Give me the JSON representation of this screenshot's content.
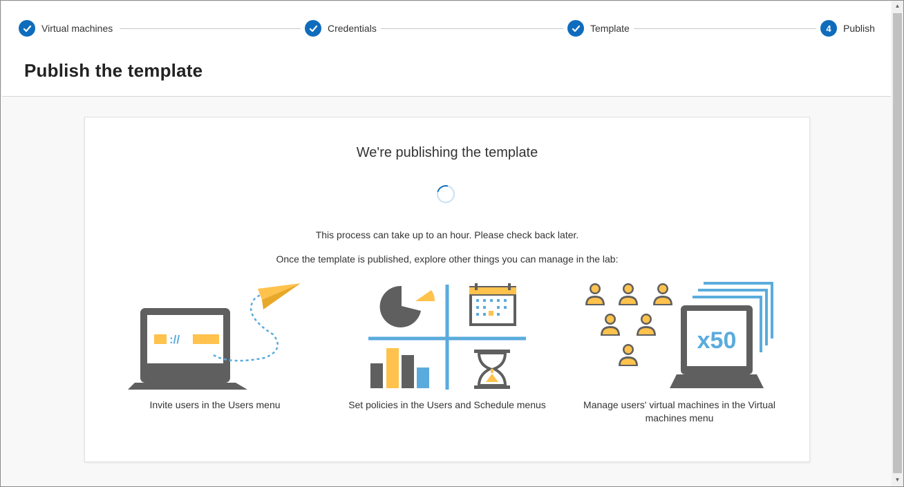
{
  "stepper": {
    "steps": [
      {
        "label": "Virtual machines",
        "state": "complete"
      },
      {
        "label": "Credentials",
        "state": "complete"
      },
      {
        "label": "Template",
        "state": "complete"
      },
      {
        "label": "Publish",
        "state": "current",
        "number": "4"
      }
    ]
  },
  "page": {
    "title": "Publish the template"
  },
  "card": {
    "heading": "We're publishing the template",
    "message_1": "This process can take up to an hour. Please check back later.",
    "message_2": "Once the template is published, explore other things you can manage in the lab:",
    "features": [
      {
        "icon": "invite-users-illustration",
        "caption": "Invite users in the Users menu"
      },
      {
        "icon": "policies-illustration",
        "caption": "Set policies in the Users and Schedule menus"
      },
      {
        "icon": "manage-vms-illustration",
        "caption": "Manage users' virtual machines in the Virtual machines menu",
        "badge": "x50"
      }
    ]
  },
  "colors": {
    "accent": "#0f6cbd",
    "gray": "#5f5f5f",
    "yellow": "#ffc24d",
    "light_blue": "#5aabdd"
  }
}
